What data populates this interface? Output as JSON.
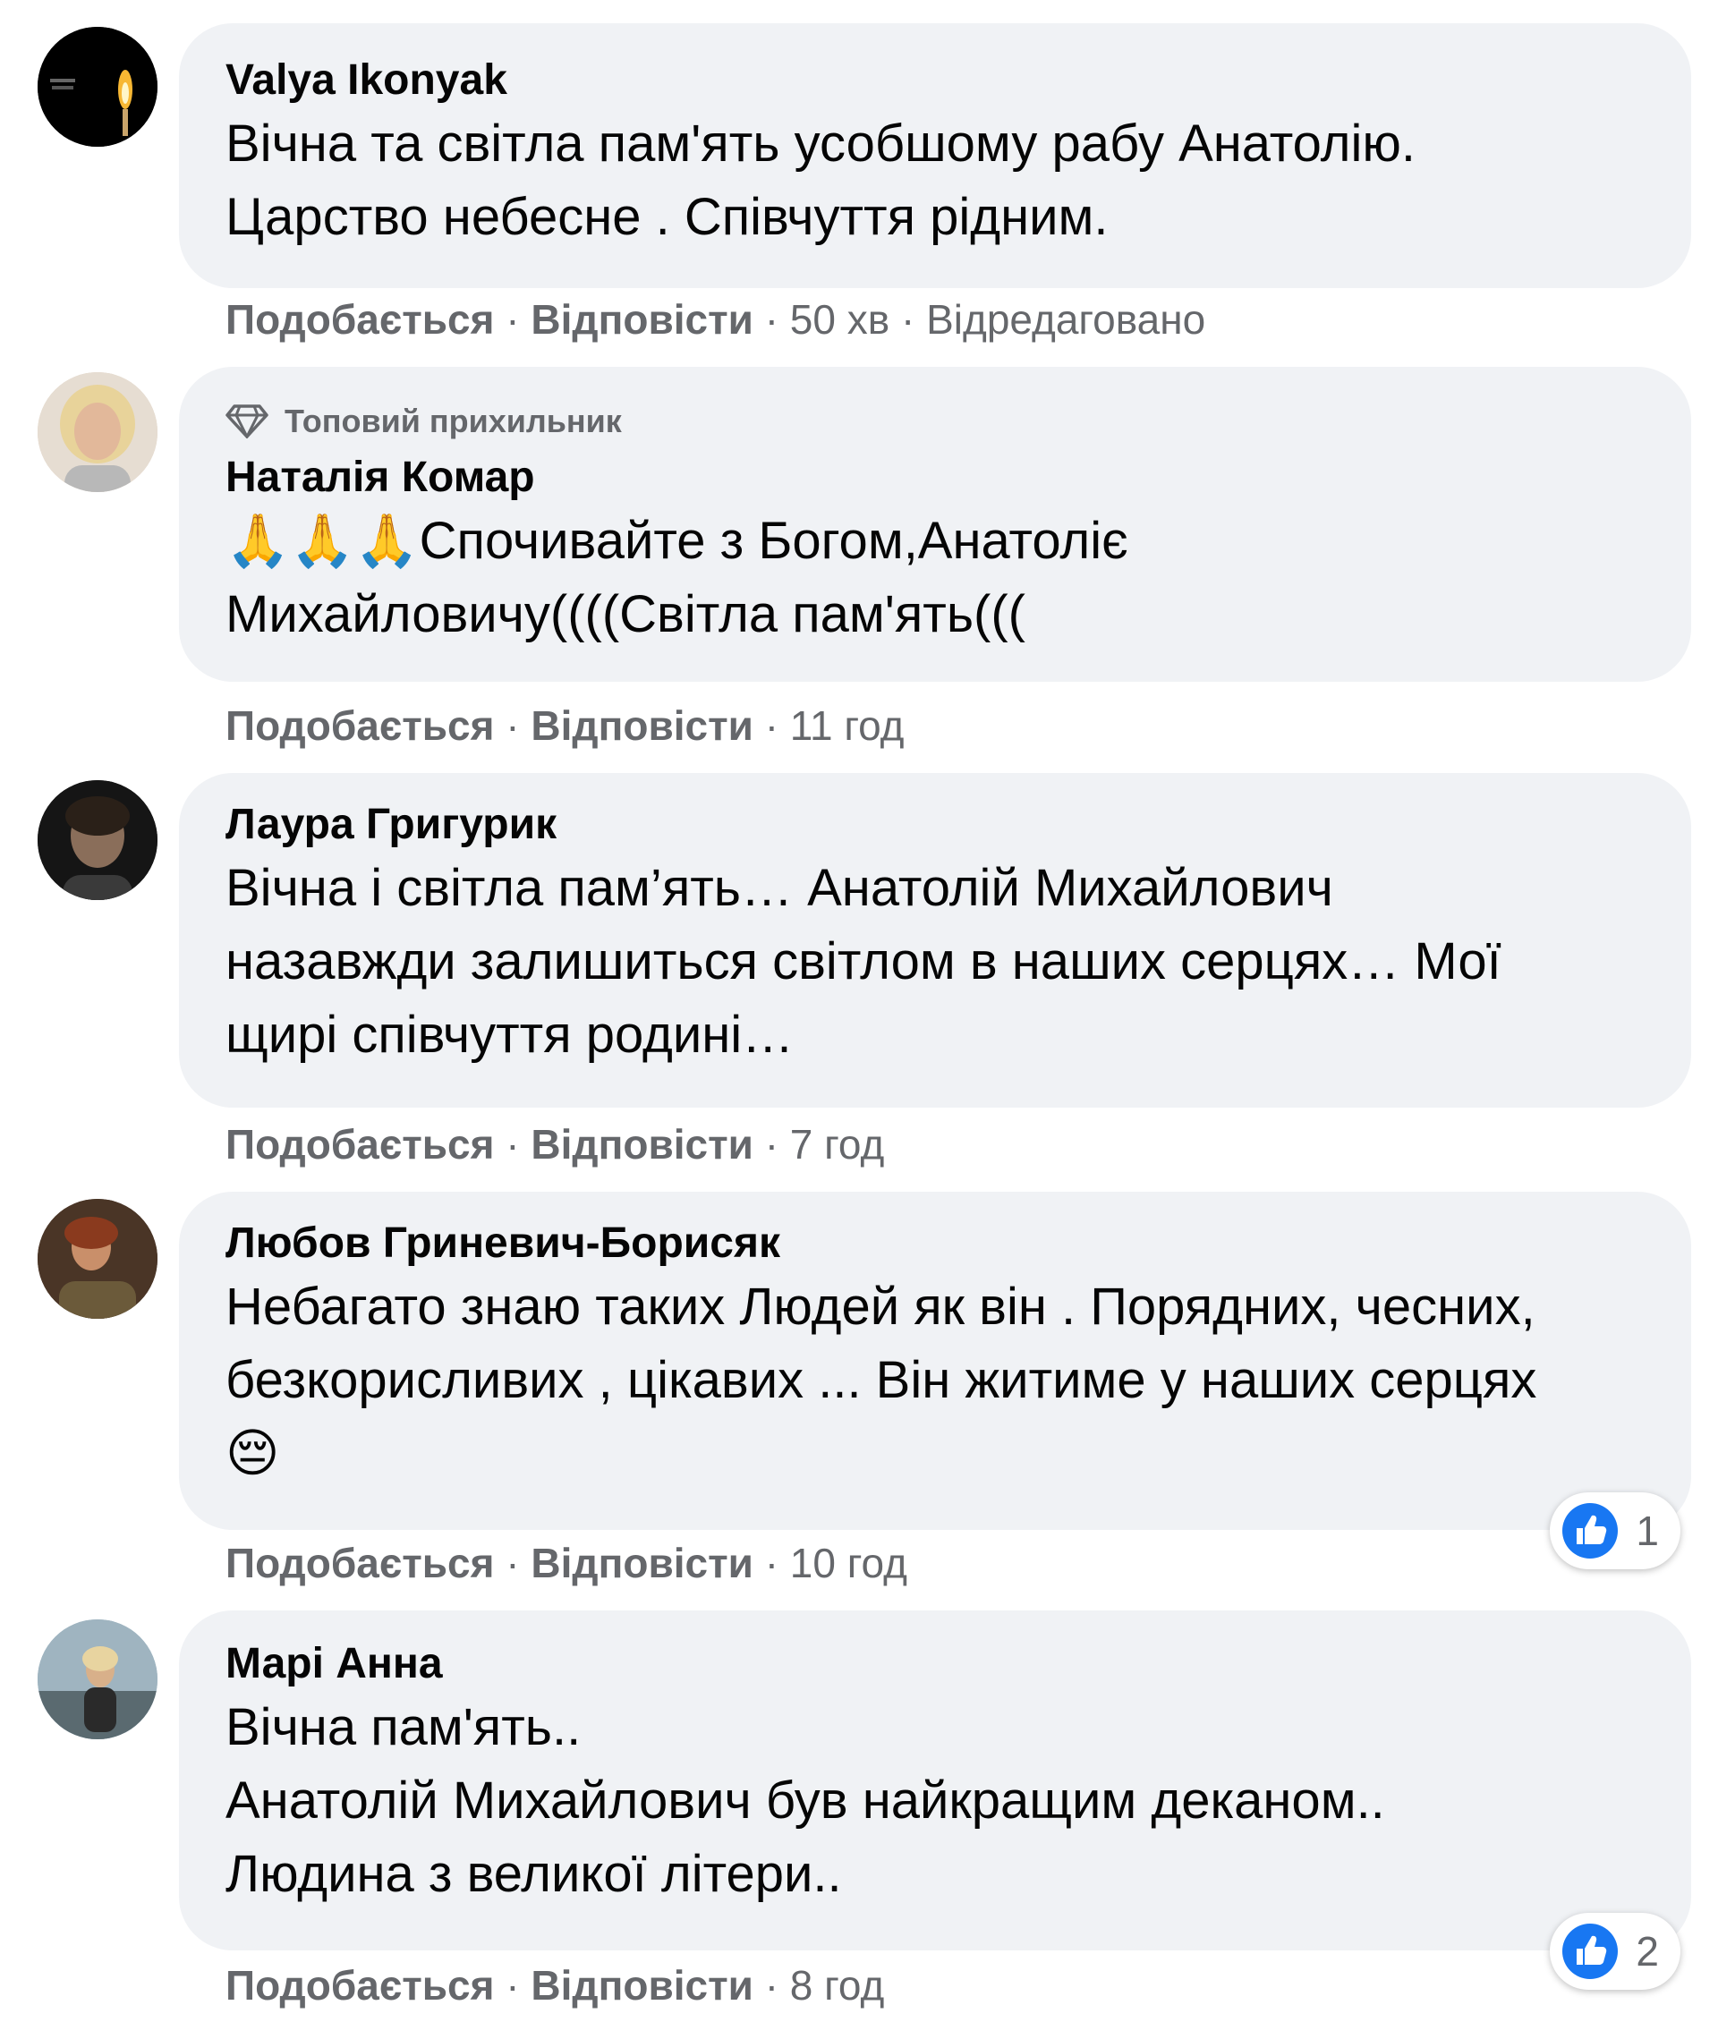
{
  "comments": [
    {
      "author": "Valya Ikonyak",
      "badge": "",
      "text": "Вічна та світла пам'ять усобшому рабу Анатолію.\nЦарство небесне . Співчуття рідним.",
      "like_label": "Подобається",
      "reply_label": "Відповісти",
      "time": "50 хв",
      "edited": "Відредаговано",
      "reactions": ""
    },
    {
      "author": "Наталія Комар",
      "badge": "Топовий прихильник",
      "text_emoji": "🙏🙏🙏",
      "text": "Спочивайте з Богом,Анатоліє\nМихайловичу((((Світла пам'ять(((",
      "like_label": "Подобається",
      "reply_label": "Відповісти",
      "time": "11 год",
      "edited": "",
      "reactions": ""
    },
    {
      "author": "Лаура Григурик",
      "badge": "",
      "text": "Вічна і світла пам’ять… Анатолій Михайлович\nназавжди залишиться світлом в наших серцях… Мої\nщирі співчуття родині…",
      "like_label": "Подобається",
      "reply_label": "Відповісти",
      "time": "7 год",
      "edited": "",
      "reactions": ""
    },
    {
      "author": "Любов Гриневич-Борисяк",
      "badge": "",
      "text": "Небагато знаю таких Людей як він . Порядних, чесних,\nбезкорисливих , цікавих ... Він житиме у наших серцях",
      "text_emoji_end": "😔",
      "like_label": "Подобається",
      "reply_label": "Відповісти",
      "time": "10 год",
      "edited": "",
      "reactions": "1"
    },
    {
      "author": "Марі Анна",
      "badge": "",
      "text": "Вічна пам'ять..\nАнатолій Михайлович був найкращим деканом..\nЛюдина з великої літери..",
      "like_label": "Подобається",
      "reply_label": "Відповісти",
      "time": "8 год",
      "edited": "",
      "reactions": "2"
    }
  ],
  "colors": {
    "bubble": "#f0f2f5",
    "meta_text": "#65676b",
    "like_blue": "#1877f2"
  },
  "icons": {
    "badge": "diamond-icon",
    "reaction": "thumbs-up-icon"
  }
}
